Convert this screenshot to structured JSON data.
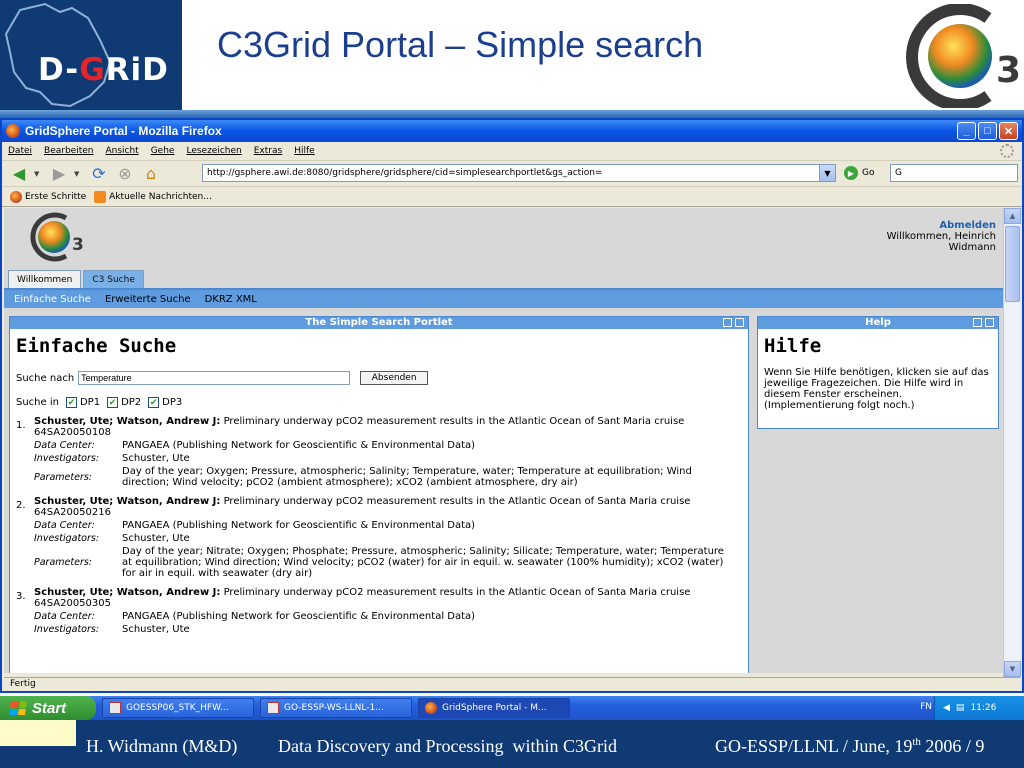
{
  "slide": {
    "title": "C3Grid Portal – Simple search",
    "dgrid_logo_text": "D-GRID"
  },
  "browser": {
    "window_title": "GridSphere Portal - Mozilla Firefox",
    "menu": [
      "Datei",
      "Bearbeiten",
      "Ansicht",
      "Gehe",
      "Lesezeichen",
      "Extras",
      "Hilfe"
    ],
    "url": "http://gsphere.awi.de:8080/gridsphere/gridsphere/cid=simplesearchportlet&gs_action=",
    "go_label": "Go",
    "search_value": "G",
    "bookmarks": [
      "Erste Schritte",
      "Aktuelle Nachrichten..."
    ],
    "status": "Fertig"
  },
  "portal": {
    "logout": "Abmelden",
    "welcome": "Willkommen, Heinrich",
    "username": "Widmann",
    "tabs": [
      "Willkommen",
      "C3 Suche"
    ],
    "subtabs": [
      "Einfache Suche",
      "Erweiterte Suche",
      "DKRZ XML"
    ],
    "main_portlet": {
      "bar_title": "The Simple Search Portlet",
      "heading": "Einfache Suche",
      "search_label": "Suche nach",
      "search_value": "Temperature",
      "submit": "Absenden",
      "search_in_label": "Suche in",
      "checkboxes": [
        "DP1",
        "DP2",
        "DP3"
      ]
    },
    "help_portlet": {
      "bar_title": "Help",
      "heading": "Hilfe",
      "text": "Wenn Sie Hilfe benötigen, klicken sie auf das jeweilige Fragezeichen. Die Hilfe wird in diesem Fenster erscheinen. (Implementierung folgt noch.)"
    },
    "results": [
      {
        "num": "1.",
        "authors": "Schuster, Ute; Watson, Andrew J:",
        "title": "Preliminary underway pCO2 measurement results in the Atlantic Ocean of Sant Maria cruise 64SA20050108",
        "data_center_label": "Data Center:",
        "data_center": "PANGAEA (Publishing Network for Geoscientific & Environmental Data)",
        "investigators_label": "Investigators:",
        "investigators": "Schuster, Ute",
        "parameters_label": "Parameters:",
        "parameters": "Day of the year; Oxygen; Pressure, atmospheric; Salinity; Temperature, water; Temperature at equilibration; Wind direction; Wind velocity; pCO2 (ambient atmosphere); xCO2 (ambient atmosphere, dry air)"
      },
      {
        "num": "2.",
        "authors": "Schuster, Ute; Watson, Andrew J:",
        "title": "Preliminary underway pCO2 measurement results in the Atlantic Ocean of Santa Maria cruise 64SA20050216",
        "data_center_label": "Data Center:",
        "data_center": "PANGAEA (Publishing Network for Geoscientific & Environmental Data)",
        "investigators_label": "Investigators:",
        "investigators": "Schuster, Ute",
        "parameters_label": "Parameters:",
        "parameters": "Day of the year; Nitrate; Oxygen; Phosphate; Pressure, atmospheric; Salinity; Silicate; Temperature, water; Temperature at equilibration; Wind direction; Wind velocity; pCO2 (water) for air in equil. w. seawater (100% humidity); xCO2 (water) for air in equil. with seawater (dry air)"
      },
      {
        "num": "3.",
        "authors": "Schuster, Ute; Watson, Andrew J:",
        "title": "Preliminary underway pCO2 measurement results in the Atlantic Ocean of Santa Maria cruise 64SA20050305",
        "data_center_label": "Data Center:",
        "data_center": "PANGAEA (Publishing Network for Geoscientific & Environmental Data)",
        "investigators_label": "Investigators:",
        "investigators": "Schuster, Ute",
        "parameters_label": "",
        "parameters": ""
      }
    ]
  },
  "taskbar": {
    "start": "Start",
    "tasks": [
      "GOESSP06_STK_HFW...",
      "GO-ESSP-WS-LLNL-1...",
      "GridSphere Portal - M..."
    ],
    "lang": "FN",
    "clock": "11:26"
  },
  "footer": {
    "author": "H. Widmann (M&D)",
    "topic": "Data Discovery and Processing  within C3Grid",
    "conf_prefix": "GO-ESSP/LLNL / June, 19",
    "conf_sup": "th",
    "conf_suffix": " 2006 / 9"
  },
  "colors": {
    "slide_blue": "#0f3a74",
    "title_blue": "#1b3f8f",
    "portlet_bar": "#5e9bdf",
    "xp_blue": "#245edb"
  }
}
